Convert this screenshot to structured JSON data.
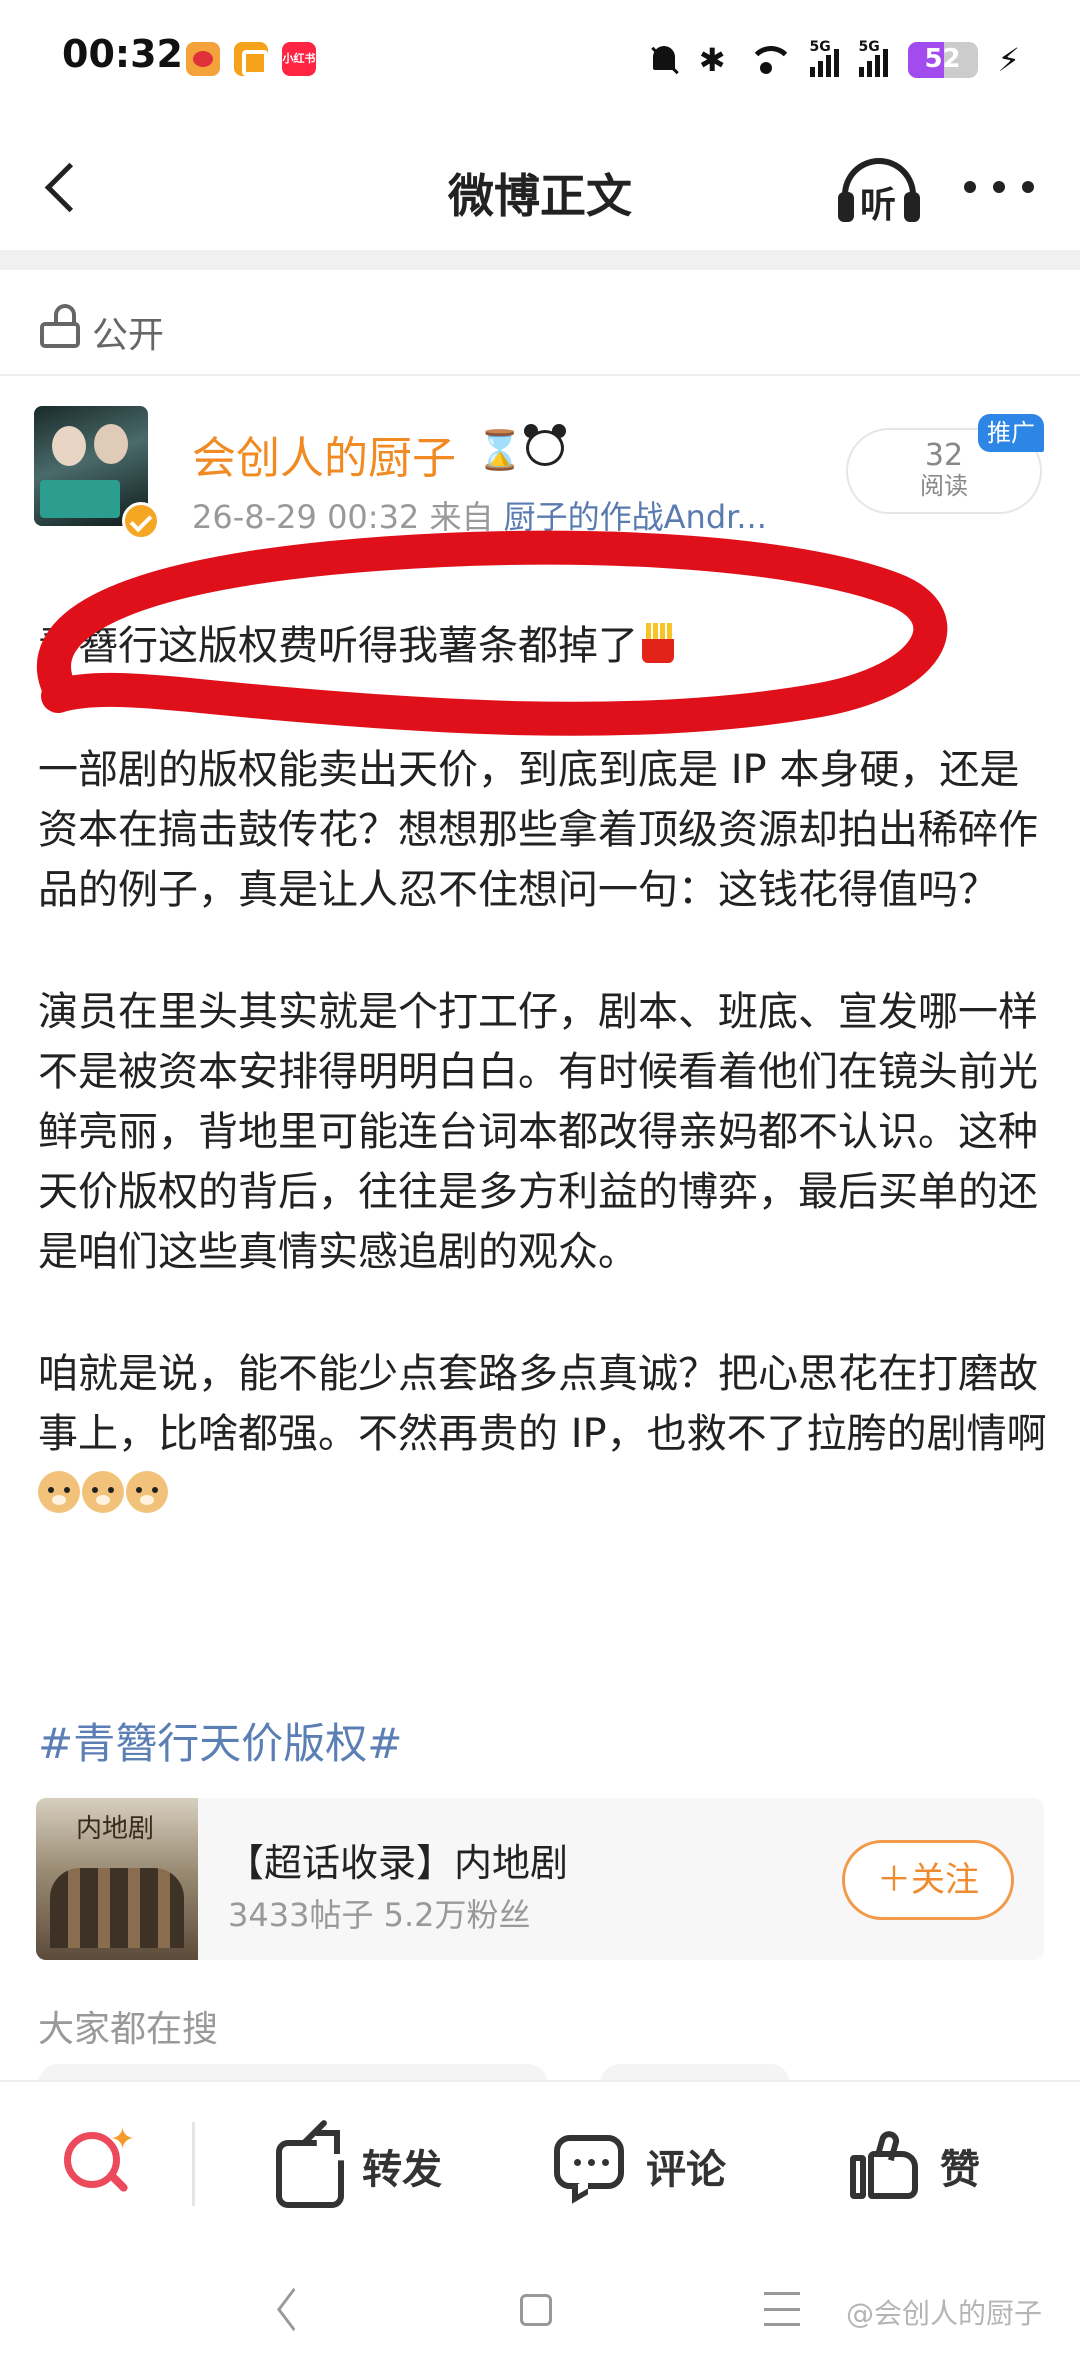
{
  "status_bar": {
    "time": "00:32",
    "signal_label_1": "5G",
    "signal_label_2": "5G",
    "battery_level": "52",
    "battery_fraction": 0.52,
    "app_badges": [
      "weibo-icon",
      "stack-app-icon",
      "xiaohongshu-icon"
    ],
    "xhs_badge_text": "小红书"
  },
  "nav": {
    "title": "微博正文",
    "listen_label": "听"
  },
  "visibility": {
    "label": "公开"
  },
  "author": {
    "name": "会创人的厨子",
    "meta_time": "26-8-29 00:32",
    "meta_from": "来自",
    "meta_source": "厨子的作战Andr...",
    "read_count": "32",
    "read_label": "阅读",
    "promo_label": "推广",
    "name_color": "#f28a23"
  },
  "post": {
    "paragraph_1": "青簪行这版权费听得我薯条都掉了",
    "paragraph_2": "一部剧的版权能卖出天价，到底到底是 IP 本身硬，还是资本在搞击鼓传花？想想那些拿着顶级资源却拍出稀碎作品的例子，真是让人忍不住想问一句：这钱花得值吗？",
    "paragraph_3": "演员在里头其实就是个打工仔，剧本、班底、宣发哪一样不是被资本安排得明明白白。有时候看着他们在镜头前光鲜亮丽，背地里可能连台词本都改得亲妈都不认识。这种天价版权的背后，往往是多方利益的博弈，最后买单的还是咱们这些真情实感追剧的观众。",
    "paragraph_4": "咱就是说，能不能少点套路多点真诚？把心思花在打磨故事上，比啥都强。不然再贵的 IP，也救不了拉胯的剧情啊",
    "hashtag": "#青簪行天价版权#"
  },
  "topic_card": {
    "thumb_text": "内地剧",
    "title": "【超话收录】内地剧",
    "stats": "3433帖子 5.2万粉丝",
    "follow_label": "＋关注",
    "accent_color": "#f19a4a"
  },
  "search_section": {
    "heading": "大家都在搜"
  },
  "action_bar": {
    "repost_label": "转发",
    "comment_label": "评论",
    "like_label": "赞",
    "search_icon_color": "#ec4a5c"
  },
  "watermark": {
    "text": "@会创人的厨子"
  },
  "annotation": {
    "color": "#e0101a"
  }
}
